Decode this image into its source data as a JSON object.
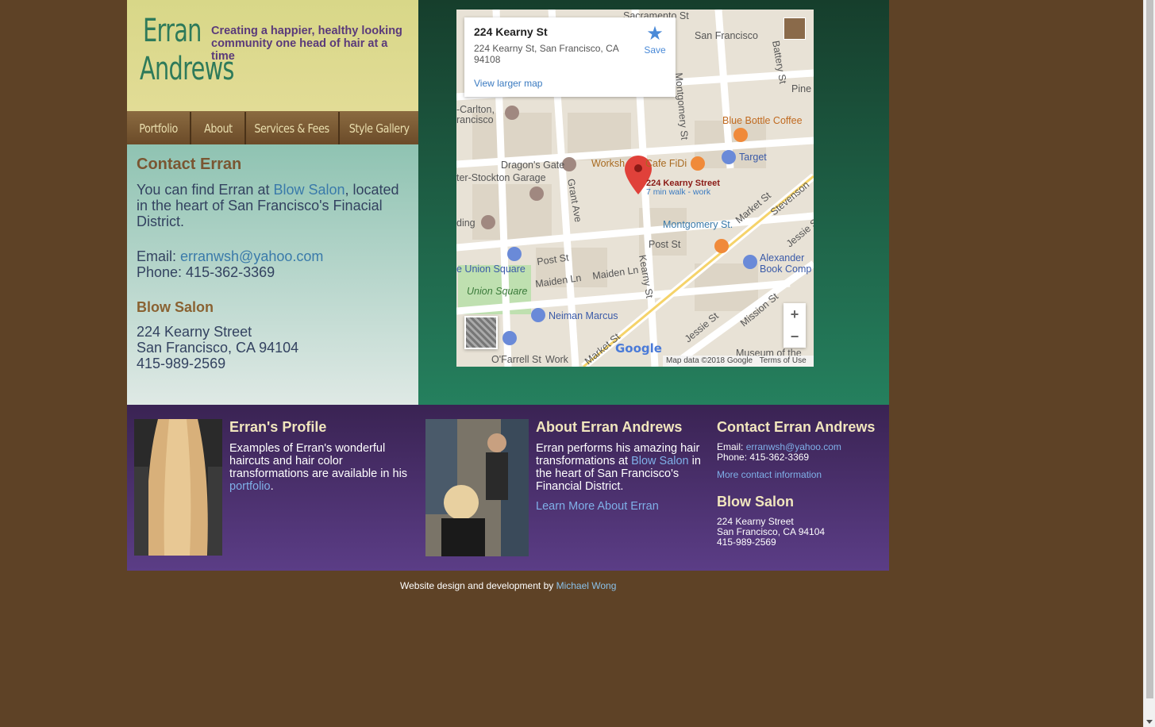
{
  "logo": {
    "line1": "Erran",
    "line2": "Andrews"
  },
  "tagline": "Creating a happier, healthy looking community one head of hair at a time",
  "nav": [
    {
      "label": "Portfolio"
    },
    {
      "label": "About"
    },
    {
      "label": "Services & Fees"
    },
    {
      "label": "Style Gallery"
    }
  ],
  "contact": {
    "title": "Contact Erran",
    "intro_before": "You can find Erran at ",
    "salon_link": "Blow Salon",
    "intro_after": ", located in the heart of San Francisco's Finacial District.",
    "email_label": "Email: ",
    "email": "erranwsh@yahoo.com",
    "phone_line": "Phone: 415-362-3369",
    "salon_title": "Blow Salon",
    "addr1": "224 Kearny Street",
    "addr2": "San Francisco, CA 94104",
    "salon_phone": "415-989-2569"
  },
  "map": {
    "card_name": "224 Kearny St",
    "card_address": "224 Kearny St, San Francisco, CA 94108",
    "larger_map": "View larger map",
    "save": "Save",
    "pin_label": "224 Kearny Street",
    "pin_sub": "7 min walk - work",
    "google": "Google",
    "map_data": "Map data ©2018 Google",
    "terms": "Terms of Use",
    "zoom_in": "+",
    "zoom_out": "−",
    "labels": {
      "sacramento": "Sacramento St",
      "sf": "San Francisco",
      "battery": "Battery St",
      "pine": "Pine",
      "carlton": "-Carlton,",
      "francisco": "rancisco",
      "montgomery_st": "Montgomery St",
      "bluebottle": "Blue Bottle Coffee",
      "dragons_gate": "Dragon's Gate",
      "workshop": "Worksh",
      "cafe": "Cafe FiDi",
      "target": "Target",
      "stockton": "ter-Stockton Garage",
      "grant": "Grant Ave",
      "market": "Market St",
      "stevenson": "Stevenson",
      "ding": "ding",
      "montgomery_station": "Montgomery St.",
      "jessie": "Jessie St",
      "post1": "Post St",
      "post2": "Post St",
      "kearny": "Kearny St",
      "alexander": "Alexander",
      "book": "Book Comp",
      "union": "e Union Square",
      "maiden1": "Maiden Ln",
      "maiden2": "Maiden Ln",
      "union_park": "Union Square",
      "neiman": "Neiman Marcus",
      "mission": "Mission St",
      "jessie2": "Jessie St",
      "museum": "Museum of the",
      "ofarrell": "O'Farrell St",
      "work": "Work",
      "market2": "Market St"
    }
  },
  "band": {
    "profile_title": "Erran's Profile",
    "profile_text": "Examples of Erran's wonderful haircuts and hair color transformations are available in his ",
    "profile_link": "portfolio",
    "profile_end": ".",
    "about_title": "About Erran Andrews",
    "about_text": "Erran performs his amazing hair transformations at ",
    "about_link": "Blow Salon",
    "about_after": " in the heart of San Francisco's Financial District.",
    "about_more": "Learn More About Erran",
    "contact_title": "Contact Erran Andrews",
    "email_label": "Email: ",
    "email": "erranwsh@yahoo.com",
    "phone": "Phone: 415-362-3369",
    "more_contact": "More contact information",
    "salon_title": "Blow Salon",
    "addr1": "224 Kearny Street",
    "addr2": "San Francisco, CA 94104",
    "salon_phone": "415-989-2569"
  },
  "credit": {
    "text": "Website design and development by ",
    "link": "Michael Wong"
  }
}
